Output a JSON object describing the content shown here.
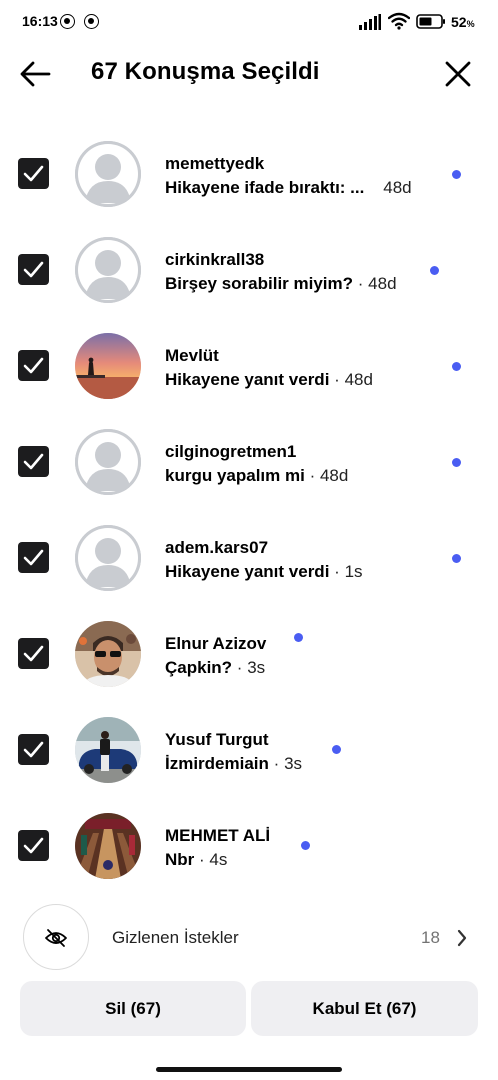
{
  "status_bar": {
    "time": "16:13",
    "battery_percent": "52",
    "battery_unit": "%"
  },
  "header": {
    "title": "67 Konuşma Seçildi"
  },
  "conversations": [
    {
      "username": "memettyedk",
      "message": "Hikayene ifade bıraktı: ...",
      "time": "48d",
      "selected": true,
      "unread": true,
      "avatar": "default"
    },
    {
      "username": "cirkinkrall38",
      "message": "Birşey sorabilir miyim?",
      "time": "48d",
      "selected": true,
      "unread": true,
      "avatar": "default"
    },
    {
      "username": "Mevlüt",
      "message": "Hikayene yanıt verdi",
      "time": "48d",
      "selected": true,
      "unread": true,
      "avatar": "sunset-photo"
    },
    {
      "username": "cilginogretmen1",
      "message": "kurgu yapalım mi",
      "time": "48d",
      "selected": true,
      "unread": true,
      "avatar": "default"
    },
    {
      "username": "adem.kars07",
      "message": "Hikayene yanıt verdi",
      "time": "1s",
      "selected": true,
      "unread": true,
      "avatar": "default"
    },
    {
      "username": "Elnur Azizov",
      "message": "Çapkin?",
      "time": "3s",
      "selected": true,
      "unread": true,
      "avatar": "man-sunglasses-photo"
    },
    {
      "username": "Yusuf Turgut",
      "message": "İzmirdemiain",
      "time": "3s",
      "selected": true,
      "unread": true,
      "avatar": "man-car-photo"
    },
    {
      "username": "MEHMET ALİ",
      "message": "Nbr",
      "time": "4s",
      "selected": true,
      "unread": true,
      "avatar": "bowling-photo"
    }
  ],
  "separator": "·",
  "hidden_requests": {
    "label": "Gizlenen İstekler",
    "count": "18"
  },
  "actions": {
    "delete_label": "Sil (67)",
    "accept_label": "Kabul Et (67)"
  },
  "colors": {
    "unread_dot": "#4a5df2",
    "checkbox": "#1c1c1e",
    "button_bg": "#efeff2"
  }
}
